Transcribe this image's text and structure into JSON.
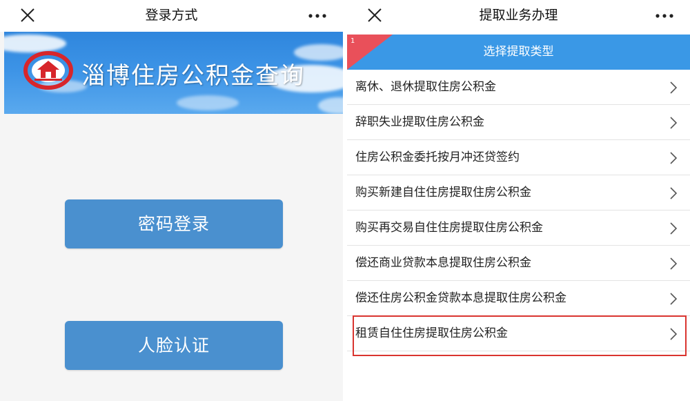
{
  "left": {
    "nav": {
      "title": "登录方式",
      "close_icon": "close-icon",
      "more_icon": "more-icon"
    },
    "banner": {
      "title": "淄博住房公积金查询",
      "logo_icon": "housing-fund-logo-icon"
    },
    "buttons": {
      "password_login": "密码登录",
      "face_auth": "人脸认证"
    }
  },
  "right": {
    "nav": {
      "title": "提取业务办理",
      "close_icon": "close-icon",
      "more_icon": "more-icon"
    },
    "header": {
      "title": "选择提取类型",
      "corner_number": "1"
    },
    "items": [
      {
        "label": "离休、退休提取住房公积金"
      },
      {
        "label": "辞职失业提取住房公积金"
      },
      {
        "label": "住房公积金委托按月冲还贷签约"
      },
      {
        "label": "购买新建自住住房提取住房公积金"
      },
      {
        "label": "购买再交易自住住房提取住房公积金"
      },
      {
        "label": "偿还商业贷款本息提取住房公积金"
      },
      {
        "label": "偿还住房公积金贷款本息提取住房公积金"
      },
      {
        "label": "租赁自住住房提取住房公积金",
        "highlighted": true
      }
    ]
  },
  "colors": {
    "button_blue": "#4a90cf",
    "header_blue": "#3a98e6",
    "corner_red": "#e9505a",
    "highlight_red": "#d9342f",
    "logo_red": "#d7262b"
  }
}
